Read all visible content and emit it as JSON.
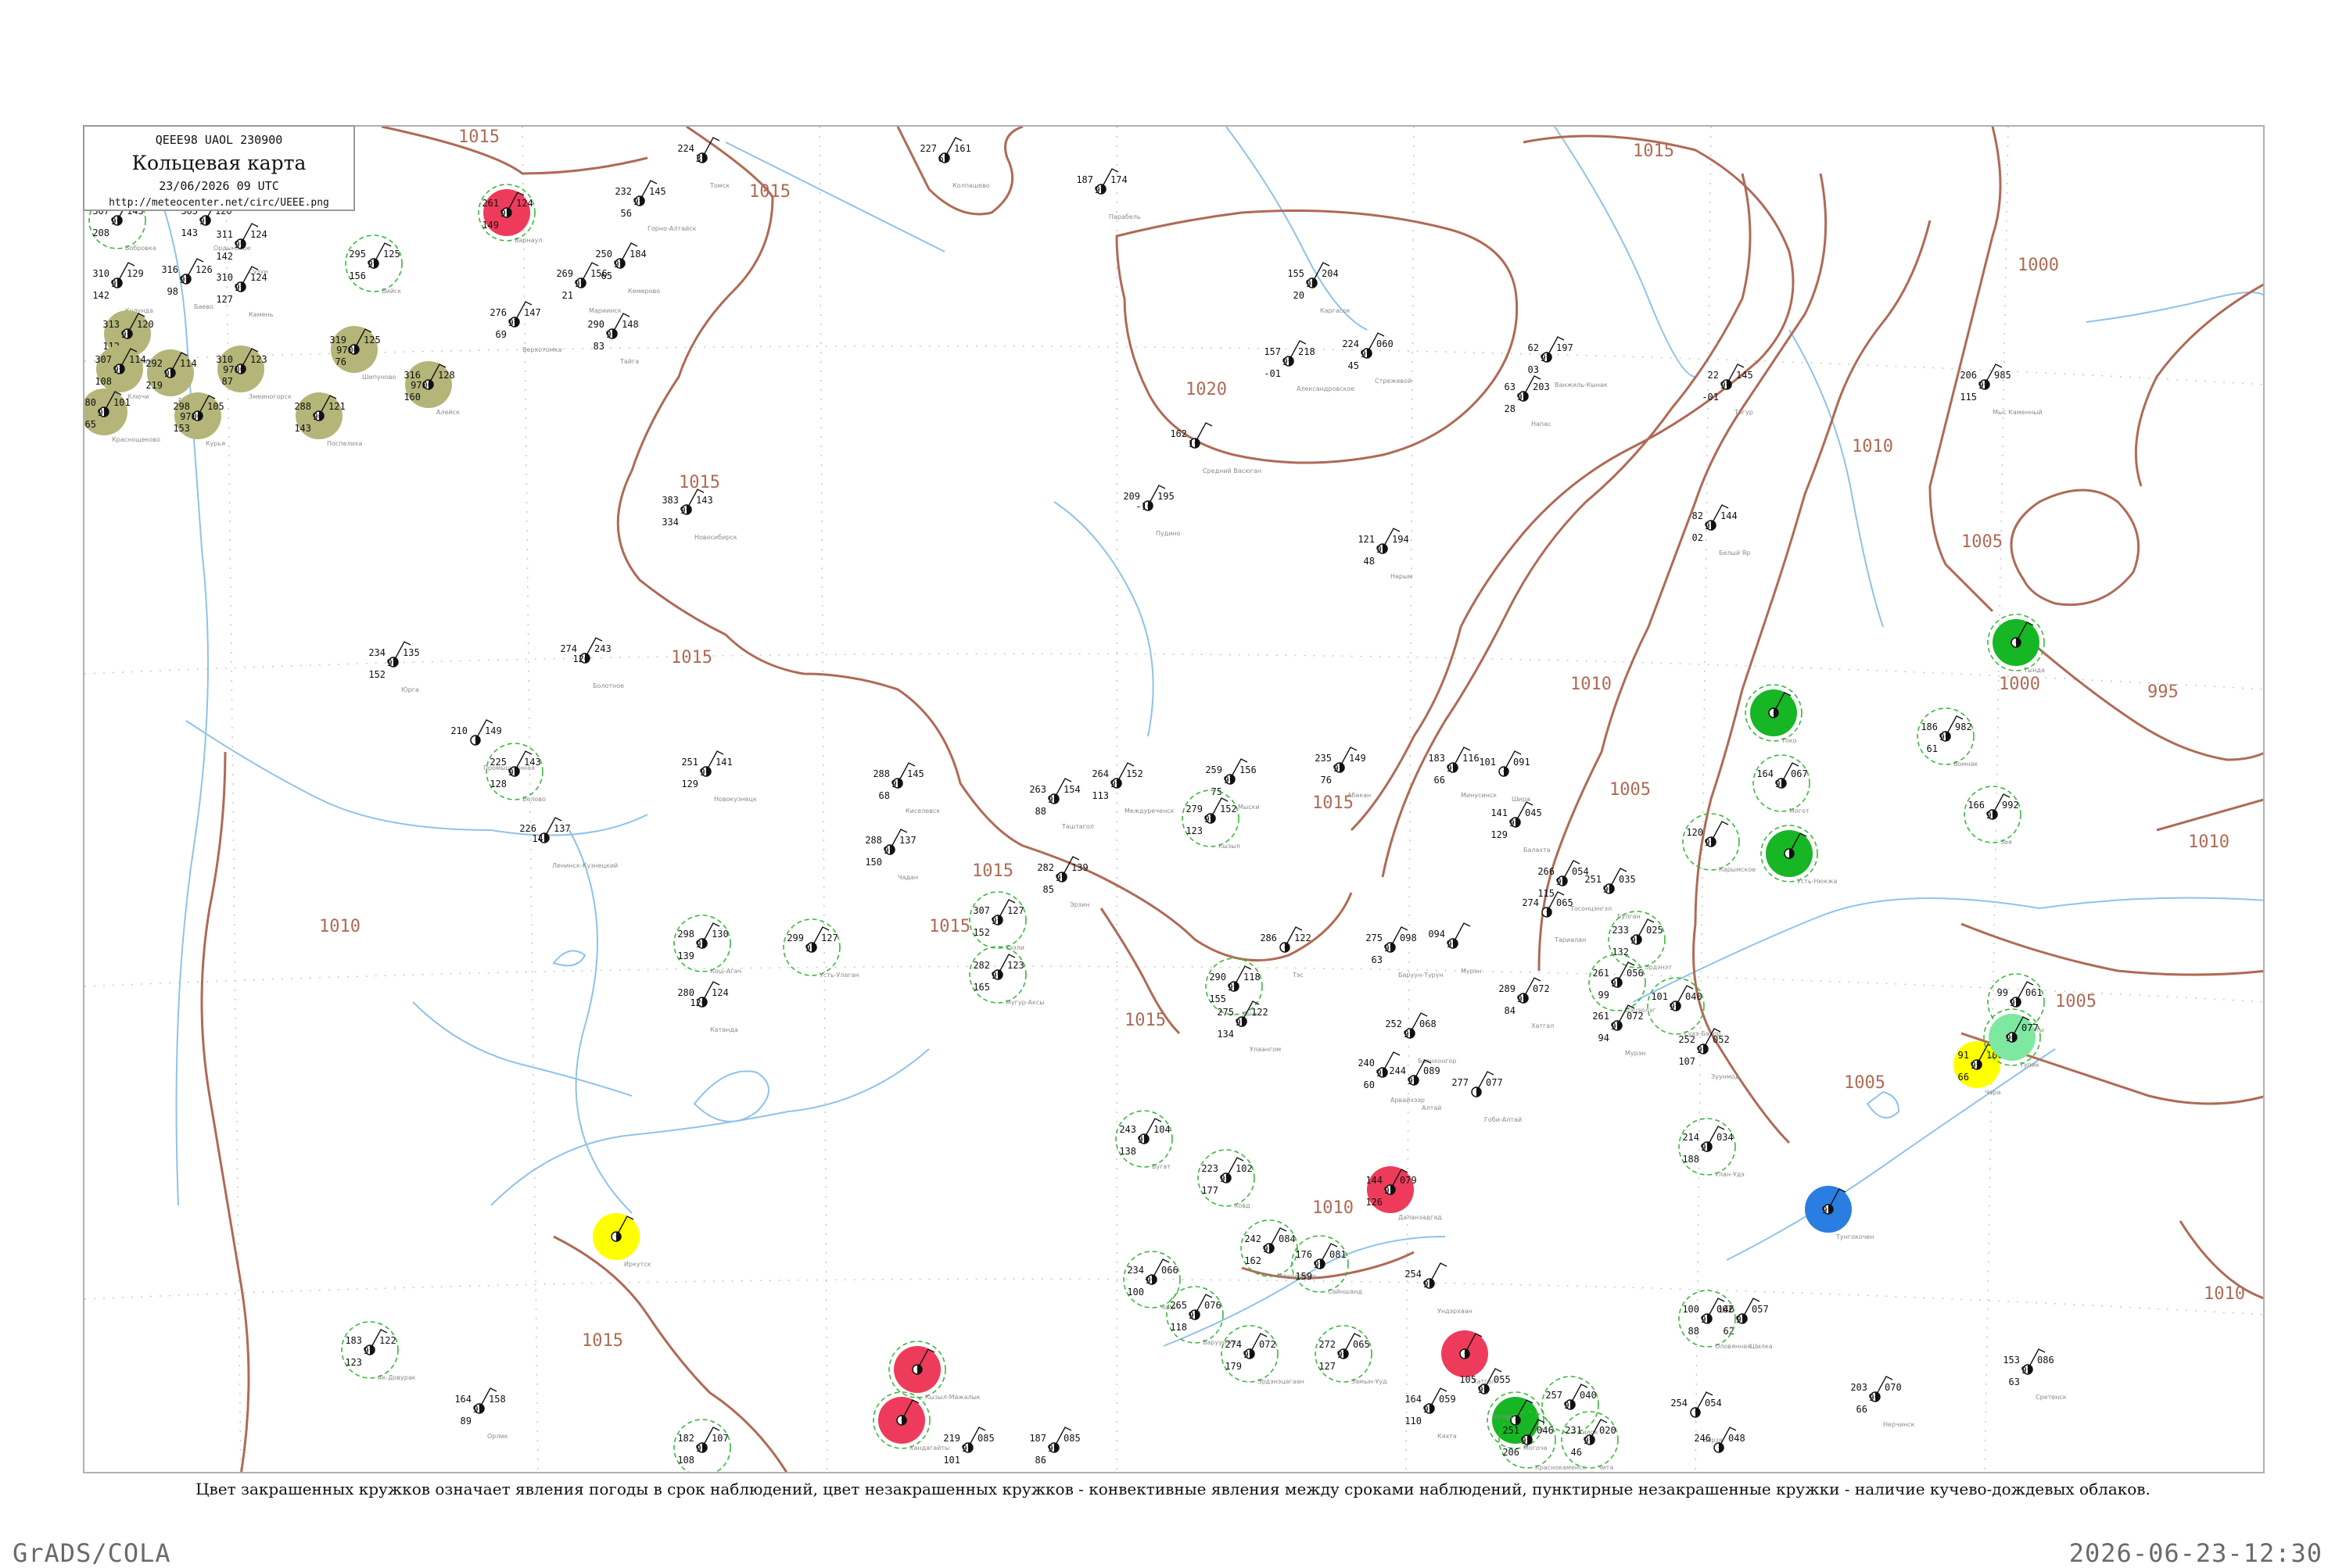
{
  "header": {
    "code": "QEEE98 UAOL 230900",
    "title": "Кольцевая карта",
    "date": "23/06/2026 09 UTC",
    "url": "http://meteocenter.net/circ/UEEE.png"
  },
  "caption": "Цвет закрашенных кружков означает явления погоды в срок наблюдений, цвет незакрашенных кружков - конвективные явления между сроками наблюдений, пунктирные незакрашенные кружки - наличие кучево-дождевых облаков.",
  "footer": {
    "left": "GrADS/COLA",
    "right": "2026-06-23-12:30"
  },
  "colors": {
    "isobar": "#b06a55",
    "river": "#8fc3e8",
    "cb_ring": "#3cb83c",
    "thunder": "#ef3b5b",
    "rain": "#17b624",
    "fog": "#b5b57a",
    "showers": "#ffff00",
    "snow": "#2a7de1",
    "drizzle": "#7ee8a0"
  },
  "isobar_labels": [
    "1015",
    "1015",
    "1015",
    "1015",
    "1020",
    "1015",
    "1015",
    "1015",
    "1010",
    "1015",
    "1010",
    "1005",
    "1005",
    "1000",
    "995",
    "1000",
    "1010",
    "1005",
    "1005",
    "1010",
    "1010",
    "1015",
    "1010",
    "1015"
  ],
  "stations": [
    {
      "id": "s01",
      "p": "318",
      "t": "97",
      "d": "140",
      "ff": "110",
      "name": "Чумыш"
    },
    {
      "id": "s02",
      "p": "312",
      "t": "97",
      "d": "149",
      "ff": "110",
      "name": "Тальменка"
    },
    {
      "id": "s03",
      "p": "307",
      "t": "97",
      "d": "208",
      "ff": "143",
      "name": "Бобровка",
      "cb": true
    },
    {
      "id": "s04",
      "p": "305",
      "t": "97",
      "d": "143",
      "ff": "120",
      "name": "Ордынское"
    },
    {
      "id": "s05",
      "p": "311",
      "t": "92",
      "d": "142",
      "ff": "124",
      "name": "Сузун"
    },
    {
      "id": "s06",
      "p": "310",
      "t": "97",
      "d": "127",
      "ff": "124",
      "name": "Камень"
    },
    {
      "id": "s07",
      "p": "316",
      "t": "97",
      "d": "98",
      "ff": "126",
      "name": "Баево"
    },
    {
      "id": "s08",
      "p": "310",
      "t": "97",
      "d": "142",
      "ff": "129",
      "name": "Кулунда"
    },
    {
      "id": "s09",
      "p": "313",
      "t": "97",
      "d": "112",
      "ff": "120",
      "name": "Славгород",
      "wx": "fog"
    },
    {
      "id": "s10",
      "p": "307",
      "t": "97",
      "d": "108",
      "ff": "114",
      "name": "Ключи",
      "wx": "fog"
    },
    {
      "id": "s11",
      "p": "292",
      "t": "97",
      "d": "219",
      "ff": "114",
      "name": "Рубцовск",
      "wx": "fog"
    },
    {
      "id": "s12",
      "p": "310",
      "t": "9700",
      "d": "87",
      "ff": "123",
      "name": "Змеиногорск",
      "wx": "fog"
    },
    {
      "id": "s13",
      "p": "319",
      "t": "9700",
      "d": "76",
      "ff": "125",
      "name": "Шипуново",
      "wx": "fog"
    },
    {
      "id": "s14",
      "p": "316",
      "t": "9700",
      "d": "160",
      "ff": "128",
      "name": "Алейск",
      "wx": "fog"
    },
    {
      "id": "s15",
      "p": "288",
      "t": "96",
      "d": "143",
      "ff": "121",
      "name": "Поспелиха",
      "wx": "fog"
    },
    {
      "id": "s16",
      "p": "298",
      "t": "9700",
      "d": "153",
      "ff": "105",
      "name": "Курья",
      "wx": "fog"
    },
    {
      "id": "s17",
      "p": "280",
      "t": "97",
      "d": "165",
      "ff": "101",
      "name": "Краснощеково",
      "wx": "fog"
    },
    {
      "id": "s18",
      "p": "295",
      "t": "97",
      "d": "156",
      "ff": "125",
      "name": "Бийск",
      "cb": true
    },
    {
      "id": "s19",
      "p": "261",
      "t": "97",
      "d": "149",
      "ff": "124",
      "name": "Барнаул",
      "wx": "thunder",
      "cb": true
    },
    {
      "id": "s20",
      "p": "232",
      "t": "97",
      "d": "56",
      "ff": "145",
      "name": "Горно-Алтайск"
    },
    {
      "id": "s21",
      "p": "250",
      "t": "97",
      "d": "65",
      "ff": "184",
      "name": "Кемерово"
    },
    {
      "id": "s22",
      "p": "269",
      "t": "97",
      "d": "21",
      "ff": "156",
      "name": "Мариинск"
    },
    {
      "id": "s23",
      "p": "290",
      "t": "97",
      "d": "83",
      "ff": "148",
      "name": "Тайга"
    },
    {
      "id": "s24",
      "p": "276",
      "t": "97",
      "d": "69",
      "ff": "147",
      "name": "Верхотомка"
    },
    {
      "id": "s25",
      "p": "224",
      "t": "35",
      "d": "",
      "ff": "",
      "name": "Томск"
    },
    {
      "id": "s26",
      "p": "227",
      "t": "61",
      "d": "",
      "ff": "161",
      "name": "Колпашево"
    },
    {
      "id": "s27",
      "p": "187",
      "t": "97",
      "d": "",
      "ff": "174",
      "name": "Парабель"
    },
    {
      "id": "s28",
      "p": "155",
      "t": "98",
      "d": "20",
      "ff": "204",
      "name": "Каргасок"
    },
    {
      "id": "s29",
      "p": "157",
      "t": "97",
      "d": "-01",
      "ff": "218",
      "name": "Александровское"
    },
    {
      "id": "s30",
      "p": "224",
      "t": "97",
      "d": "45",
      "ff": "060",
      "name": "Стрежевой"
    },
    {
      "id": "s31",
      "p": "162",
      "t": "11",
      "d": "",
      "ff": "",
      "name": "Средний Васюган"
    },
    {
      "id": "s32",
      "p": "62",
      "t": "97",
      "d": "03",
      "ff": "197",
      "name": "Ванжиль-Кынак"
    },
    {
      "id": "s33",
      "p": "63",
      "t": "97",
      "d": "28",
      "ff": "203",
      "name": "Напас"
    },
    {
      "id": "s34",
      "p": "22",
      "t": "97",
      "d": "-01",
      "ff": "145",
      "name": "Тогур"
    },
    {
      "id": "s35",
      "p": "206",
      "t": "97",
      "d": "115",
      "ff": "985",
      "name": "Мыс Каменный"
    },
    {
      "id": "s36",
      "p": "209",
      "t": "-16",
      "d": "",
      "ff": "195",
      "name": "Пудино"
    },
    {
      "id": "s37",
      "p": "121",
      "t": "97",
      "d": "48",
      "ff": "194",
      "name": "Нарым"
    },
    {
      "id": "s38",
      "p": "82",
      "t": "97",
      "d": "02",
      "ff": "144",
      "name": "Белый Яр"
    },
    {
      "id": "s39",
      "p": "383",
      "t": "97",
      "d": "334",
      "ff": "143",
      "name": "Новосибирск"
    },
    {
      "id": "s40",
      "p": "274",
      "t": "126",
      "d": "",
      "ff": "243",
      "name": "Болотное"
    },
    {
      "id": "s41",
      "p": "234",
      "t": "97",
      "d": "152",
      "ff": "135",
      "name": "Юрга"
    },
    {
      "id": "s42",
      "p": "210",
      "t": "",
      "d": "",
      "ff": "149",
      "name": "Промышленная"
    },
    {
      "id": "s43",
      "p": "226",
      "t": "147",
      "d": "",
      "ff": "137",
      "name": "Ленинск-Кузнецкий"
    },
    {
      "id": "s44",
      "p": "225",
      "t": "97",
      "d": "128",
      "ff": "143",
      "name": "Белово",
      "cb": true
    },
    {
      "id": "s45",
      "p": "251",
      "t": "97",
      "d": "129",
      "ff": "141",
      "name": "Новокузнецк"
    },
    {
      "id": "s46",
      "p": "288",
      "t": "97",
      "d": "68",
      "ff": "145",
      "name": "Киселевск"
    },
    {
      "id": "s47",
      "p": "263",
      "t": "97",
      "d": "88",
      "ff": "154",
      "name": "Таштагол"
    },
    {
      "id": "s48",
      "p": "264",
      "t": "97",
      "d": "113",
      "ff": "152",
      "name": "Междуреченск"
    },
    {
      "id": "s49",
      "p": "259",
      "t": "97",
      "d": "75",
      "ff": "156",
      "name": "Мыски"
    },
    {
      "id": "s50",
      "p": "235",
      "t": "97",
      "d": "76",
      "ff": "149",
      "name": "Абакан"
    },
    {
      "id": "s51",
      "p": "183",
      "t": "97",
      "d": "66",
      "ff": "116",
      "name": "Минусинск"
    },
    {
      "id": "s52",
      "p": "101",
      "t": "",
      "d": "",
      "ff": "091",
      "name": "Шира"
    },
    {
      "id": "s53",
      "p": "141",
      "t": "97",
      "d": "129",
      "ff": "045",
      "name": "Балахта"
    },
    {
      "id": "s54",
      "p": "279",
      "t": "97",
      "d": "123",
      "ff": "152",
      "name": "Кызыл",
      "cb": true
    },
    {
      "id": "s55",
      "p": "282",
      "t": "97",
      "d": "85",
      "ff": "139",
      "name": "Эрзин"
    },
    {
      "id": "s56",
      "p": "288",
      "t": "97",
      "d": "150",
      "ff": "137",
      "name": "Чадан"
    },
    {
      "id": "s57",
      "p": "307",
      "t": "97",
      "d": "152",
      "ff": "127",
      "name": "Тээли",
      "cb": true
    },
    {
      "id": "s58",
      "p": "282",
      "t": "97",
      "d": "165",
      "ff": "123",
      "name": "Мугур-Аксы",
      "cb": true
    },
    {
      "id": "s59",
      "p": "298",
      "t": "97",
      "d": "139",
      "ff": "130",
      "name": "Кош-Агач",
      "cb": true
    },
    {
      "id": "s60",
      "p": "299",
      "t": "97",
      "d": "",
      "ff": "127",
      "name": "Усть-Улаган",
      "cb": true
    },
    {
      "id": "s61",
      "p": "280",
      "t": "120",
      "d": "",
      "ff": "124",
      "name": "Катанда"
    },
    {
      "id": "s62",
      "p": "290",
      "t": "97",
      "d": "155",
      "ff": "118",
      "name": "Ханх",
      "cb": true
    },
    {
      "id": "s63",
      "p": "275",
      "t": "97",
      "d": "134",
      "ff": "122",
      "name": "Улаангом"
    },
    {
      "id": "s64",
      "p": "286",
      "t": "",
      "d": "",
      "ff": "122",
      "name": "Тэс"
    },
    {
      "id": "s65",
      "p": "275",
      "t": "97",
      "d": "63",
      "ff": "098",
      "name": "Баруун-Турун"
    },
    {
      "id": "s66",
      "p": "094",
      "t": "97",
      "d": "",
      "ff": "",
      "name": "Мурэн"
    },
    {
      "id": "s67",
      "p": "266",
      "t": "97",
      "d": "115",
      "ff": "054",
      "name": "Тосонцэнгэл"
    },
    {
      "id": "s68",
      "p": "274",
      "t": "",
      "d": "",
      "ff": "065",
      "name": "Тариалан"
    },
    {
      "id": "s69",
      "p": "251",
      "t": "90",
      "d": "",
      "ff": "035",
      "name": "Булган"
    },
    {
      "id": "s70",
      "p": "233",
      "t": "97",
      "d": "132",
      "ff": "025",
      "name": "Эрдэнэт",
      "cb": true
    },
    {
      "id": "s71",
      "p": "261",
      "t": "97",
      "d": "99",
      "ff": "056",
      "name": "Цэцэрлэг",
      "cb": true
    },
    {
      "id": "s72",
      "p": "289",
      "t": "97",
      "d": "84",
      "ff": "072",
      "name": "Хатгал"
    },
    {
      "id": "s73",
      "p": "261",
      "t": "97",
      "d": "94",
      "ff": "072",
      "name": "Мурэн"
    },
    {
      "id": "s74",
      "p": "101",
      "t": "97",
      "d": "",
      "ff": "040",
      "name": "Сухэ-Батор",
      "cb": true
    },
    {
      "id": "s75",
      "p": "252",
      "t": "97",
      "d": "107",
      "ff": "052",
      "name": "Зуунмод"
    },
    {
      "id": "s76",
      "p": "252",
      "t": "97",
      "d": "",
      "ff": "068",
      "name": "Баянхонгор"
    },
    {
      "id": "s77",
      "p": "240",
      "t": "97",
      "d": "60",
      "ff": "",
      "name": "Арвайхээр"
    },
    {
      "id": "s78",
      "p": "244",
      "t": "97",
      "d": "",
      "ff": "089",
      "name": "Алтай"
    },
    {
      "id": "s79",
      "p": "277",
      "t": "",
      "d": "",
      "ff": "077",
      "name": "Гоби-Алтай"
    },
    {
      "id": "s80",
      "p": "214",
      "t": "97",
      "d": "188",
      "ff": "034",
      "name": "Улан-Удэ",
      "cb": true
    },
    {
      "id": "s81",
      "p": "243",
      "t": "97",
      "d": "138",
      "ff": "104",
      "name": "Бугат",
      "cb": true
    },
    {
      "id": "s82",
      "p": "223",
      "t": "97",
      "d": "177",
      "ff": "102",
      "name": "Ховд",
      "cb": true
    },
    {
      "id": "s83",
      "p": "144",
      "t": "97",
      "d": "126",
      "ff": "079",
      "name": "Даланзадгад",
      "wx": "thunder"
    },
    {
      "id": "s84",
      "p": "242",
      "t": "97",
      "d": "162",
      "ff": "084",
      "name": "Мандалговь",
      "cb": true
    },
    {
      "id": "s85",
      "p": "176",
      "t": "97",
      "d": "159",
      "ff": "081",
      "name": "Сайншанд",
      "cb": true
    },
    {
      "id": "s86",
      "p": "234",
      "t": "97",
      "d": "100",
      "ff": "066",
      "name": "Чойр",
      "cb": true
    },
    {
      "id": "s87",
      "p": "254",
      "t": "97",
      "d": "",
      "ff": "",
      "name": "Ундэрхаан"
    },
    {
      "id": "s88",
      "p": "265",
      "t": "97",
      "d": "118",
      "ff": "076",
      "name": "Баруун-Урт",
      "cb": true
    },
    {
      "id": "s89",
      "p": "274",
      "t": "97",
      "d": "179",
      "ff": "072",
      "name": "Эрдэнэцагаан",
      "cb": true
    },
    {
      "id": "s90",
      "p": "272",
      "t": "97",
      "d": "127",
      "ff": "065",
      "name": "Замын-Ууд",
      "cb": true
    },
    {
      "id": "s91",
      "p": "",
      "t": "",
      "d": "",
      "ff": "",
      "name": "Хатгал",
      "wx": "thunder"
    },
    {
      "id": "s92",
      "p": "164",
      "t": "97",
      "d": "110",
      "ff": "059",
      "name": "Кяхта"
    },
    {
      "id": "s93",
      "p": "257",
      "t": "97",
      "d": "",
      "ff": "040",
      "name": "Хилок",
      "cb": true
    },
    {
      "id": "s94",
      "p": "231",
      "t": "97",
      "d": "46",
      "ff": "020",
      "name": "Чита",
      "cb": true
    },
    {
      "id": "s95",
      "p": "",
      "t": "",
      "d": "",
      "ff": "",
      "name": "Могоча",
      "wx": "rain",
      "cb": true
    },
    {
      "id": "s96",
      "p": "254",
      "t": "",
      "d": "",
      "ff": "054",
      "name": "Борзя"
    },
    {
      "id": "s97",
      "p": "246",
      "t": "",
      "d": "",
      "ff": "048",
      "name": "Нерчинский Завод"
    },
    {
      "id": "s98",
      "p": "251",
      "t": "97",
      "d": "206",
      "ff": "046",
      "name": "Краснокаменск",
      "cb": true
    },
    {
      "id": "s99",
      "p": "105",
      "t": "97",
      "d": "",
      "ff": "055",
      "name": "Балей"
    },
    {
      "id": "s100",
      "p": "183",
      "t": "97",
      "d": "123",
      "ff": "122",
      "name": "Ак-Довурак",
      "cb": true
    },
    {
      "id": "s101",
      "p": "164",
      "t": "97",
      "d": "89",
      "ff": "158",
      "name": "Орлик"
    },
    {
      "id": "s102",
      "p": "182",
      "t": "97",
      "d": "108",
      "ff": "107",
      "name": "Монды",
      "cb": true
    },
    {
      "id": "s103",
      "p": "219",
      "t": "97",
      "d": "101",
      "ff": "085",
      "name": "Кырен"
    },
    {
      "id": "s104",
      "p": "187",
      "t": "97",
      "d": "86",
      "ff": "085",
      "name": "Слюдянка"
    },
    {
      "id": "s105",
      "p": "146",
      "t": "97",
      "d": "62",
      "ff": "057",
      "name": "Шилка"
    },
    {
      "id": "s106",
      "p": "203",
      "t": "97",
      "d": "66",
      "ff": "070",
      "name": "Нерчинск"
    },
    {
      "id": "s107",
      "p": "153",
      "t": "97",
      "d": "63",
      "ff": "086",
      "name": "Сретенск"
    },
    {
      "id": "s108",
      "p": "100",
      "t": "97",
      "d": "88",
      "ff": "062",
      "name": "Оловянная",
      "cb": true
    },
    {
      "id": "s109",
      "p": "99",
      "t": "97",
      "d": "",
      "ff": "061",
      "name": "Улёты",
      "cb": true
    },
    {
      "id": "s110",
      "p": "91",
      "t": "93",
      "d": "66",
      "ff": "106",
      "name": "Чара",
      "wx": "showers"
    },
    {
      "id": "s111",
      "p": "",
      "t": "96",
      "d": "",
      "ff": "077",
      "name": "Тупик",
      "wx": "drizzle",
      "cb": true
    },
    {
      "id": "s112",
      "p": "",
      "t": "97",
      "d": "",
      "ff": "",
      "name": "Тунгокочен",
      "wx": "snow"
    },
    {
      "id": "s113",
      "p": "120",
      "t": "97",
      "d": "",
      "ff": "",
      "name": "Карымское",
      "cb": true
    },
    {
      "id": "s114",
      "p": "186",
      "t": "97",
      "d": "61",
      "ff": "982",
      "name": "Бомнак",
      "cb": true
    },
    {
      "id": "s115",
      "p": "166",
      "t": "97",
      "d": "",
      "ff": "992",
      "name": "Зея",
      "cb": true
    },
    {
      "id": "s116",
      "p": "",
      "t": "",
      "d": "",
      "ff": "",
      "name": "Тында",
      "wx": "rain",
      "cb": true
    },
    {
      "id": "s117",
      "p": "",
      "t": "",
      "d": "",
      "ff": "",
      "name": "Токо",
      "wx": "rain",
      "cb": true
    },
    {
      "id": "s118",
      "p": "",
      "t": "",
      "d": "",
      "ff": "",
      "name": "Усть-Нюкжа",
      "wx": "rain",
      "cb": true
    },
    {
      "id": "s119",
      "p": "164",
      "t": "97",
      "d": "",
      "ff": "067",
      "name": "Могот",
      "cb": true
    },
    {
      "id": "s120",
      "p": "",
      "t": "",
      "d": "",
      "ff": "",
      "name": "Иркутск",
      "wx": "showers"
    },
    {
      "id": "s121",
      "p": "",
      "t": "",
      "d": "",
      "ff": "",
      "name": "Кызыл-Мажалык",
      "wx": "thunder",
      "cb": true
    },
    {
      "id": "s122",
      "p": "",
      "t": "",
      "d": "",
      "ff": "",
      "name": "Хандагайты",
      "wx": "thunder",
      "cb": true
    }
  ]
}
